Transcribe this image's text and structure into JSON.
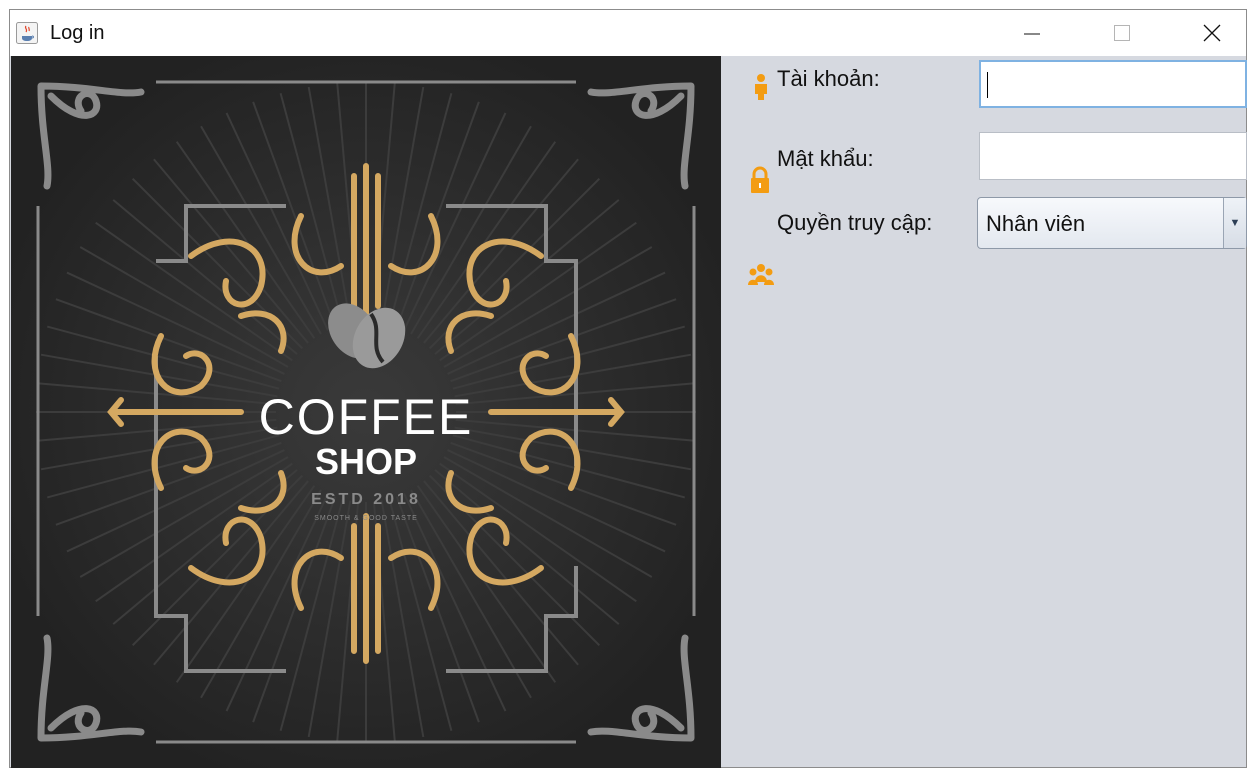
{
  "window": {
    "title": "Log in",
    "buttons": {
      "minimize": "minimize",
      "maximize": "maximize",
      "close": "close"
    }
  },
  "logo": {
    "line1": "COFFEE",
    "line2": "SHOP",
    "established": "ESTD 2018",
    "tagline": "SMOOTH & GOOD TASTE",
    "colors": {
      "background": "#2a2a2a",
      "gold": "#d4a861",
      "gray": "#8a8a8a",
      "text": "#ffffff"
    }
  },
  "form": {
    "username": {
      "label": "Tài khoản:",
      "value": "",
      "icon": "user-icon"
    },
    "password": {
      "label": "Mật khẩu:",
      "value": "",
      "icon": "lock-icon"
    },
    "role": {
      "label": "Quyền truy cập:",
      "selected": "Nhân viên",
      "icon": "group-icon"
    },
    "accent_color": "#f39c12"
  }
}
